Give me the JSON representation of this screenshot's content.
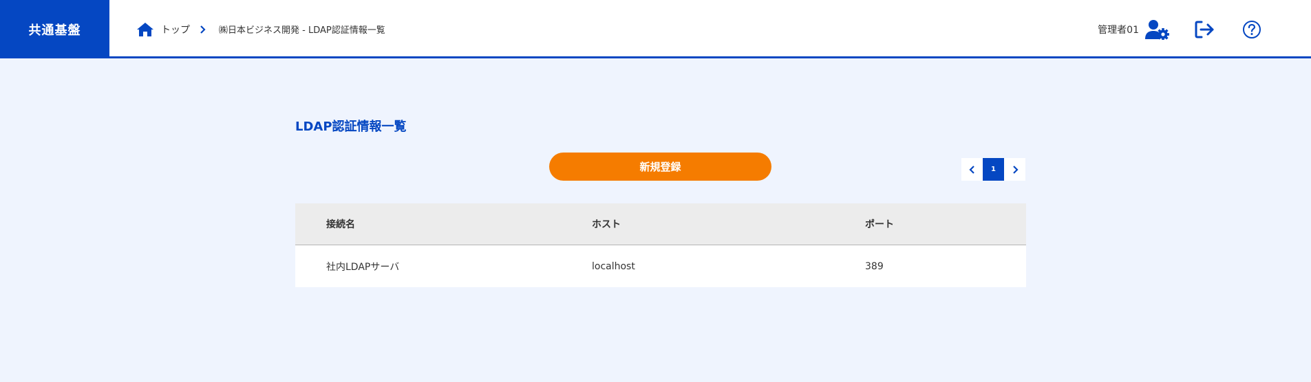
{
  "brand": "共通基盤",
  "breadcrumb": {
    "home": "トップ",
    "current": "㈱日本ビジネス開発 - LDAP認証情報一覧"
  },
  "user": {
    "name": "管理者01"
  },
  "page": {
    "title": "LDAP認証情報一覧",
    "new_button": "新規登録"
  },
  "pagination": {
    "current": "1"
  },
  "table": {
    "headers": [
      "接続名",
      "ホスト",
      "ポート"
    ],
    "rows": [
      [
        "社内LDAPサーバ",
        "localhost",
        "389"
      ]
    ]
  },
  "colors": {
    "primary": "#0547c2",
    "accent": "#f57c00",
    "background": "#eff4fe"
  },
  "icons": [
    "home-icon",
    "chevron-right-icon",
    "user-gear-icon",
    "logout-icon",
    "help-icon",
    "chevron-left-icon"
  ]
}
